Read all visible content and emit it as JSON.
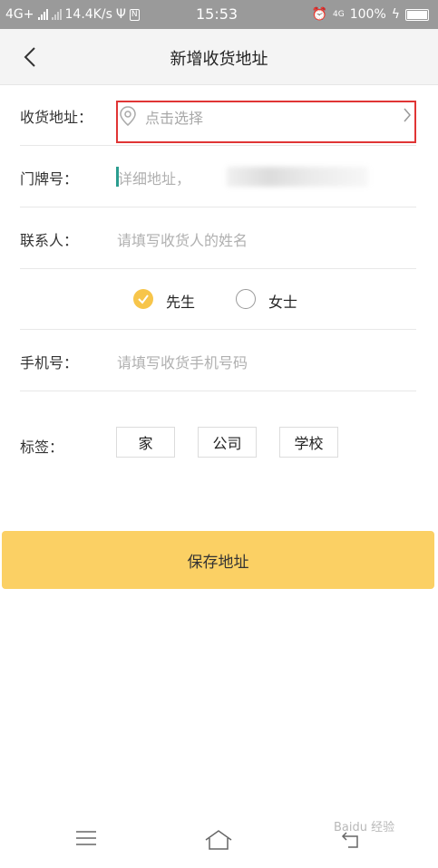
{
  "status_bar": {
    "network": "4G+",
    "speed": "14.4K/s",
    "time": "15:53",
    "net2": "4G",
    "battery": "100%",
    "nfc_badge": "N"
  },
  "header": {
    "title": "新增收货地址"
  },
  "form": {
    "address": {
      "label": "收货地址：",
      "placeholder": "点击选择"
    },
    "door": {
      "label": "门牌号：",
      "placeholder": "详细地址，"
    },
    "contact": {
      "label": "联系人：",
      "placeholder": "请填写收货人的姓名"
    },
    "gender": {
      "options": [
        {
          "label": "先生",
          "selected": true
        },
        {
          "label": "女士",
          "selected": false
        }
      ]
    },
    "phone": {
      "label": "手机号：",
      "placeholder": "请填写收货手机号码"
    },
    "tags": {
      "label": "标签：",
      "options": [
        "家",
        "公司",
        "学校"
      ]
    }
  },
  "save_button": {
    "label": "保存地址"
  },
  "colors": {
    "accent": "#fbd064",
    "radio_selected": "#f7c54a",
    "highlight_border": "#e03535"
  },
  "bottom_nav": {
    "icons": [
      "menu-icon",
      "home-icon",
      "back-icon"
    ]
  },
  "watermark": {
    "text": "Baidu 经验"
  }
}
